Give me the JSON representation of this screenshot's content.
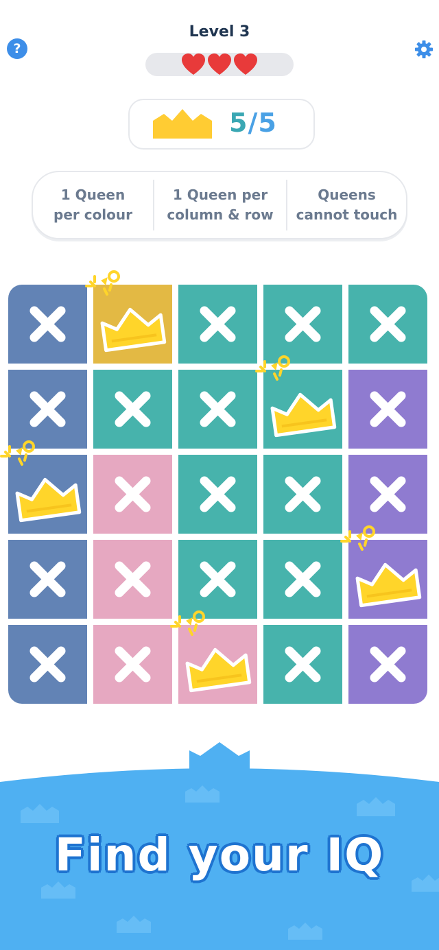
{
  "header": {
    "level": "Level 3",
    "lives": 3,
    "help_icon": "question-mark-icon",
    "settings_icon": "gear-icon"
  },
  "progress": {
    "placed": "5",
    "slash": "/",
    "total": "5",
    "icon": "crown-icon"
  },
  "rules": [
    {
      "line1": "1 Queen",
      "line2": "per colour"
    },
    {
      "line1": "1 Queen per",
      "line2": "column & row"
    },
    {
      "line1": "Queens",
      "line2": "cannot touch"
    }
  ],
  "colors": {
    "slate": "#6283b5",
    "gold": "#e3b944",
    "teal": "#47b3ac",
    "purple": "#8f7bd0",
    "pink": "#e6a8c1",
    "accent_blue": "#4aa1e5",
    "crown_yellow": "#ffd52a",
    "heart_red": "#e83a3a"
  },
  "board": {
    "size": 5,
    "regions": [
      [
        "slate",
        "gold",
        "teal",
        "teal",
        "teal"
      ],
      [
        "slate",
        "teal",
        "teal",
        "teal",
        "purple"
      ],
      [
        "slate",
        "pink",
        "teal",
        "teal",
        "purple"
      ],
      [
        "slate",
        "pink",
        "teal",
        "teal",
        "purple"
      ],
      [
        "slate",
        "pink",
        "pink",
        "teal",
        "purple"
      ]
    ],
    "queens": [
      [
        0,
        1
      ],
      [
        1,
        3
      ],
      [
        2,
        0
      ],
      [
        3,
        4
      ],
      [
        4,
        2
      ]
    ]
  },
  "promo": {
    "tagline": "Find your IQ"
  }
}
